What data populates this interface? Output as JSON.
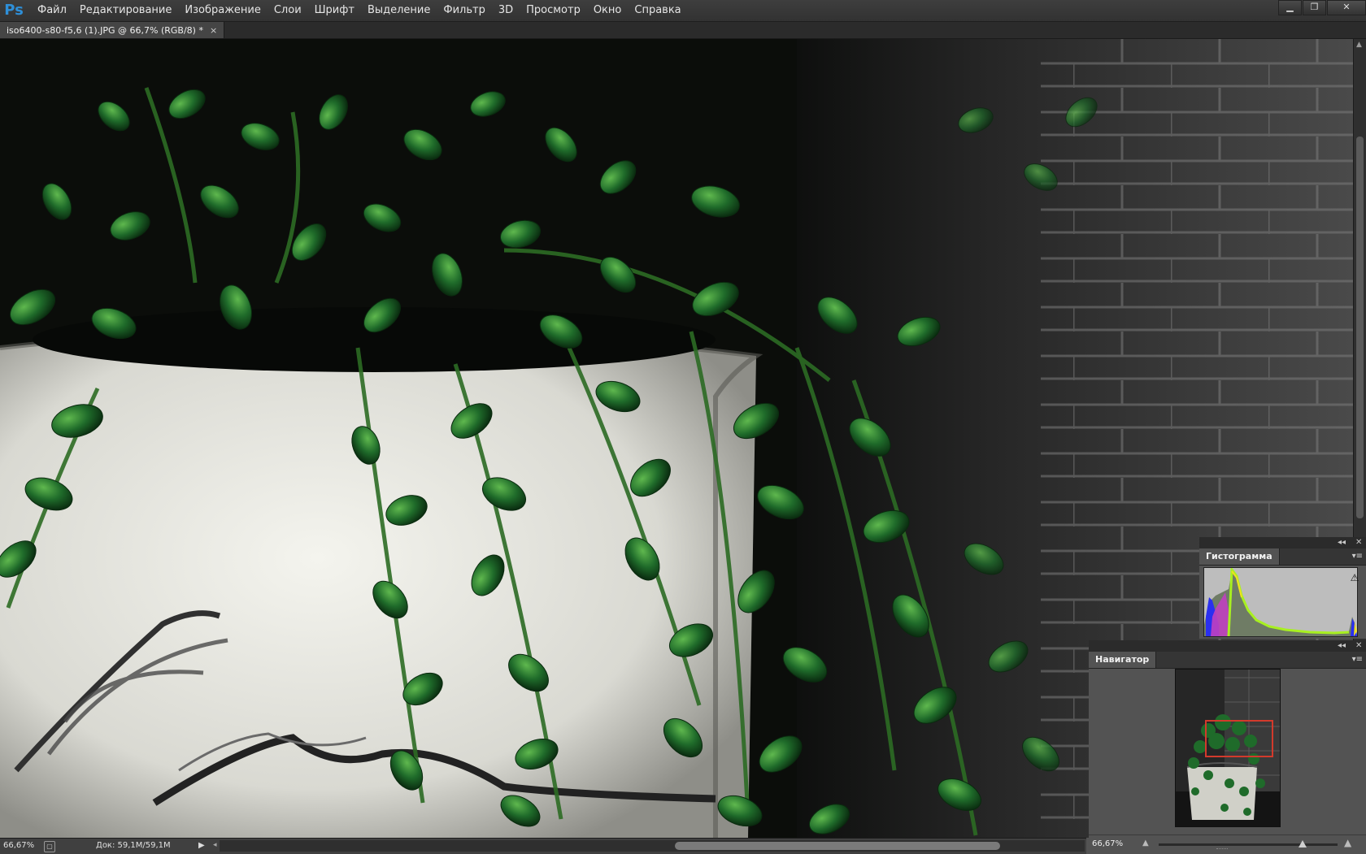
{
  "app": {
    "logo": "Ps",
    "menus": [
      "Файл",
      "Редактирование",
      "Изображение",
      "Слои",
      "Шрифт",
      "Выделение",
      "Фильтр",
      "3D",
      "Просмотр",
      "Окно",
      "Справка"
    ],
    "window_controls": {
      "minimize": "▁",
      "restore": "❐",
      "close": "✕"
    }
  },
  "document": {
    "tab_title": "iso6400-s80-f5,6 (1).JPG @ 66,7% (RGB/8) *",
    "tab_close": "×"
  },
  "status_bar": {
    "zoom": "66,67%",
    "doc_info": "Док: 59,1M/59,1M",
    "menu_arrow": "▶",
    "scroll_left": "◂"
  },
  "panels": {
    "histogram": {
      "tab_label": "Гистограмма",
      "strip_collapse": "◂◂",
      "strip_close": "✕",
      "menu": "▾≡",
      "warning_icon": "⚠"
    },
    "navigator": {
      "tab_label": "Навигатор",
      "strip_collapse": "◂◂",
      "strip_close": "✕",
      "menu": "▾≡",
      "zoom": "66,67%",
      "zoom_out": "▲",
      "zoom_in": "▲"
    }
  },
  "colors": {
    "accent_blue": "#2e8fd8",
    "navigator_proxy": "#d33a2c",
    "panel_bg": "#535353",
    "menubar_bg": "#323232",
    "leaf_green": "#1f6b2a"
  },
  "canvas": {
    "image_description_icon": "photo-canvas"
  }
}
